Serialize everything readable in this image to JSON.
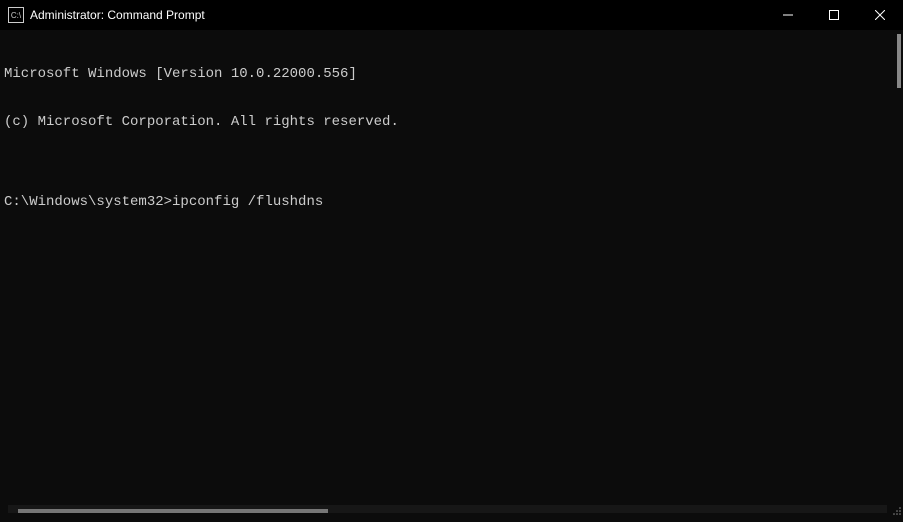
{
  "window": {
    "title": "Administrator: Command Prompt",
    "icon_label": "C:\\"
  },
  "terminal": {
    "header_line1": "Microsoft Windows [Version 10.0.22000.556]",
    "header_line2": "(c) Microsoft Corporation. All rights reserved.",
    "blank": "",
    "prompt": "C:\\Windows\\system32>",
    "command": "ipconfig /flushdns"
  }
}
